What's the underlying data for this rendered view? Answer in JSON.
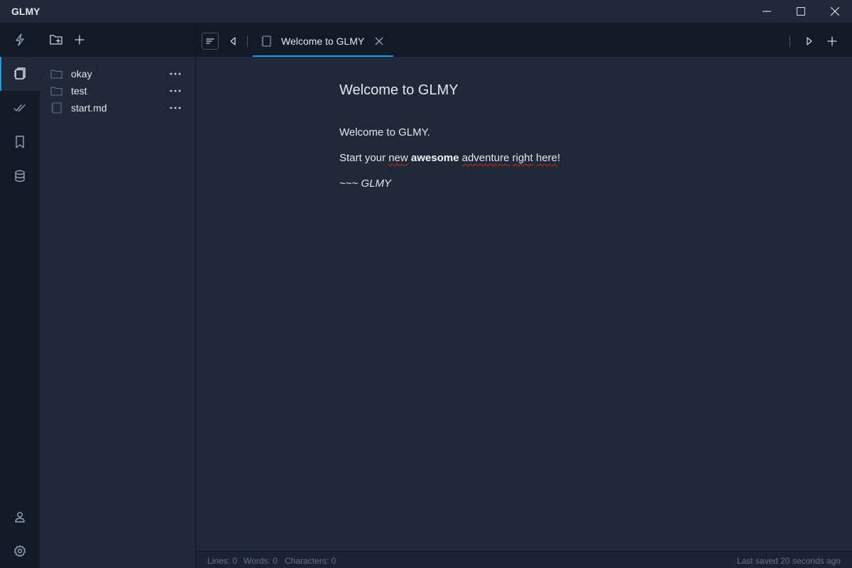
{
  "app": {
    "title": "GLMY"
  },
  "window_controls": [
    {
      "name": "minimize-button",
      "icon": "minimize-icon"
    },
    {
      "name": "maximize-button",
      "icon": "maximize-icon"
    },
    {
      "name": "close-window-button",
      "icon": "close-icon"
    }
  ],
  "activity_bar": {
    "items": [
      {
        "name": "quick-actions",
        "icon": "lightning-icon",
        "active": false
      },
      {
        "name": "notes",
        "icon": "notebook-icon",
        "active": true
      },
      {
        "name": "tasks",
        "icon": "double-check-icon",
        "active": false
      },
      {
        "name": "bookmarks",
        "icon": "bookmark-icon",
        "active": false
      },
      {
        "name": "database",
        "icon": "database-icon",
        "active": false
      },
      {
        "name": "account",
        "icon": "user-icon",
        "active": false
      },
      {
        "name": "settings",
        "icon": "gear-icon",
        "active": false
      }
    ]
  },
  "explorer": {
    "toolbar": [
      {
        "name": "new-folder",
        "icon": "folder-plus-icon"
      },
      {
        "name": "new-file",
        "icon": "plus-icon"
      }
    ],
    "items": [
      {
        "label": "okay",
        "type": "folder",
        "icon": "folder-icon"
      },
      {
        "label": "test",
        "type": "folder",
        "icon": "folder-icon"
      },
      {
        "label": "start.md",
        "type": "file",
        "icon": "file-icon"
      }
    ]
  },
  "tabs": [
    {
      "label": "Welcome to GLMY",
      "active": true,
      "icon": "file-icon"
    }
  ],
  "document": {
    "title": "Welcome to GLMY",
    "line1": "Welcome to GLMY.",
    "line2": {
      "w1": "Start your ",
      "w2": "new",
      "w3": " ",
      "w4": "awesome",
      "w5": " ",
      "w6": "adventure",
      "w7": " ",
      "w8": "right",
      "w9": " ",
      "w10": "here",
      "w11": "!"
    },
    "line3": "~~~ GLMY"
  },
  "status": {
    "lines": "Lines: 0",
    "words": "Words: 0",
    "characters": "Characters: 0",
    "last_saved": "Last saved 20 seconds ago"
  },
  "colors": {
    "accent": "#0ea5e9",
    "background": "#1f2937",
    "sidebar": "#131a27",
    "spellcheck": "#dc2626"
  }
}
